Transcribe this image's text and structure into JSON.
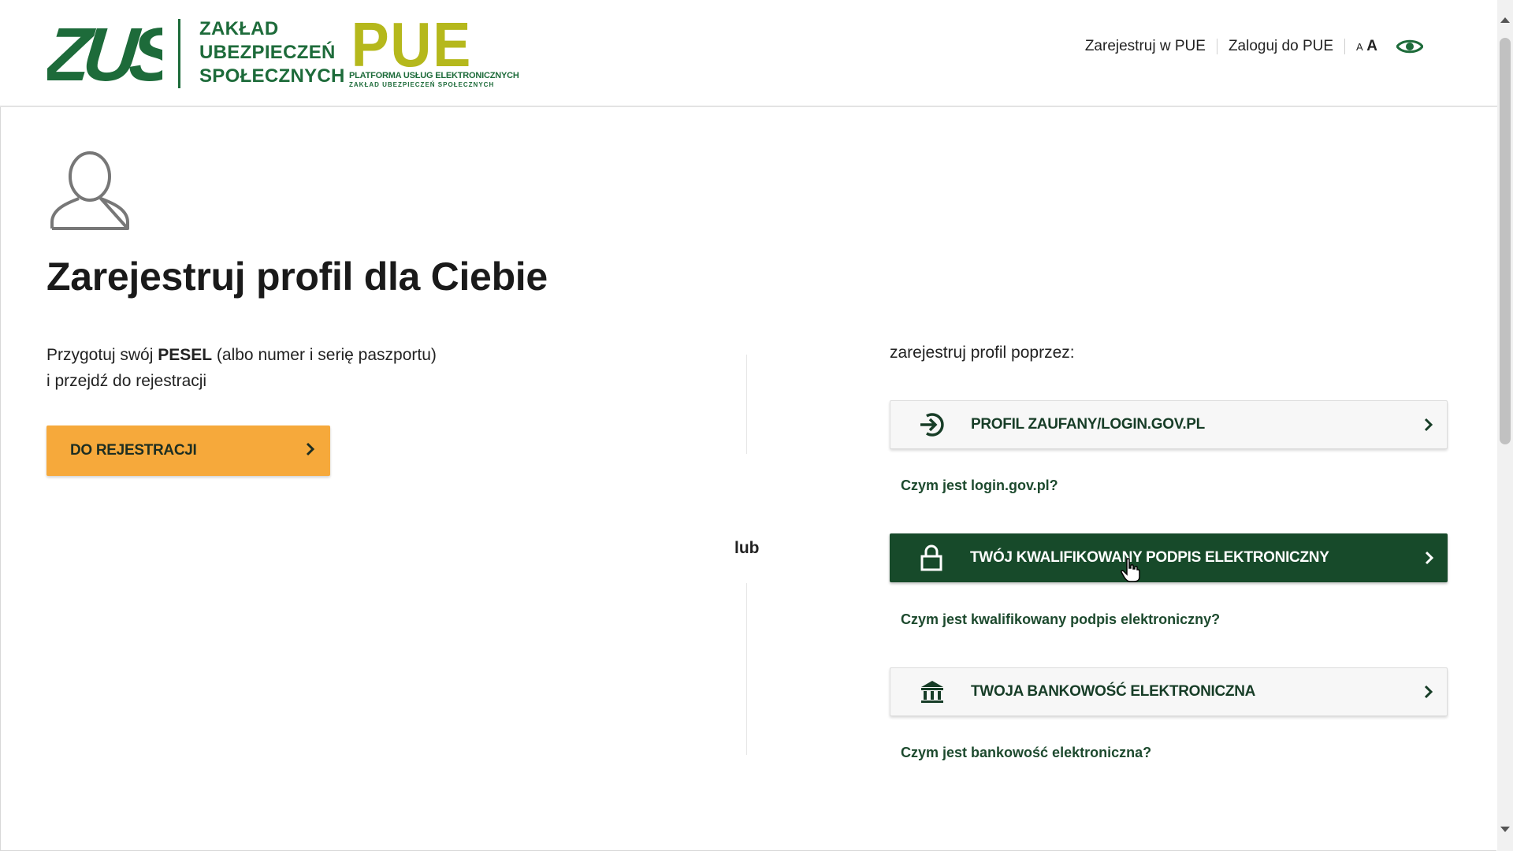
{
  "header": {
    "logo_text": "ZUS",
    "org_name_lines": [
      "ZAKŁAD",
      "UBEZPIECZEŃ",
      "SPOŁECZNYCH"
    ],
    "pue_logo_text": "PUE",
    "pue_caption": "PLATFORMA USŁUG ELEKTRONICZNYCH",
    "pue_subcaption": "ZAKŁAD UBEZPIECZEŃ SPOŁECZNYCH",
    "nav": {
      "register": "Zarejestruj w PUE",
      "login": "Zaloguj do PUE",
      "font_small": "A",
      "font_large": "A"
    },
    "icons": {
      "contrast": "eye-icon"
    }
  },
  "main": {
    "title": "Zarejestruj profil dla Ciebie",
    "prep_line1_before": "Przygotuj swój ",
    "prep_line1_bold": "PESEL",
    "prep_line1_after": " (albo numer i serię paszportu)",
    "prep_line2": "i przejdź do rejestracji",
    "register_button": "DO REJESTRACJI",
    "or_label": "lub",
    "through_label": "zarejestruj profil poprzez:",
    "options": [
      {
        "label": "PROFIL ZAUFANY/LOGIN.GOV.PL",
        "icon": "login-arrow-icon",
        "help": "Czym jest login.gov.pl?"
      },
      {
        "label": "TWÓJ KWALIFIKOWANY PODPIS ELEKTRONICZNY",
        "icon": "lock-icon",
        "help": "Czym jest kwalifikowany podpis elektroniczny?"
      },
      {
        "label": "TWOJA BANKOWOŚĆ ELEKTRONICZNA",
        "icon": "bank-icon",
        "help": "Czym jest bankowość elektroniczna?"
      }
    ]
  },
  "colors": {
    "brand_green": "#1d6b3a",
    "dark_green": "#174a2a",
    "pue_yellow": "#b5b81c",
    "accent_orange": "#f6a93b"
  }
}
